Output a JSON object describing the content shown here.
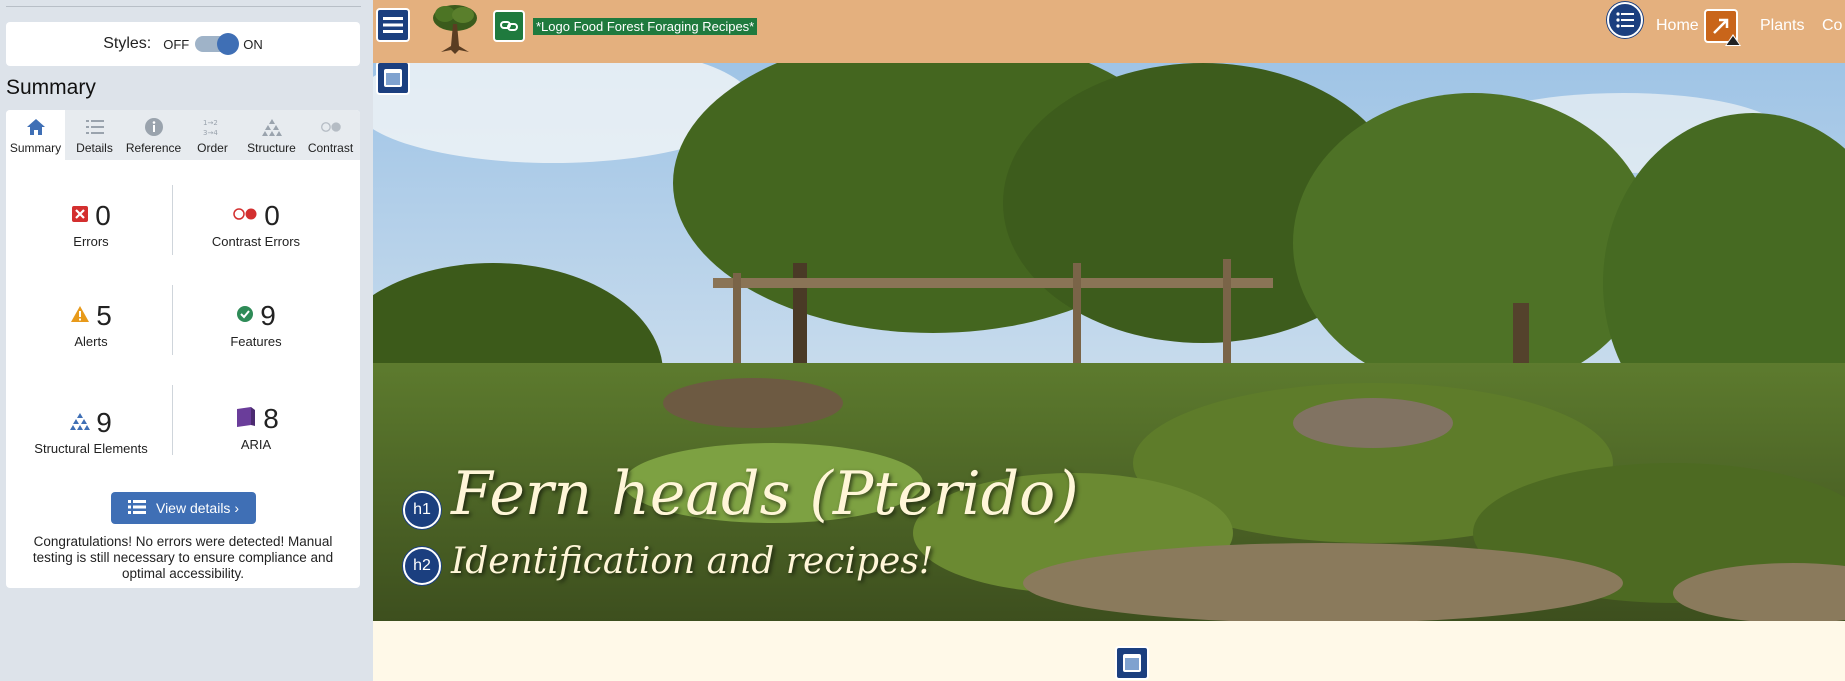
{
  "panel": {
    "styles_label": "Styles:",
    "styles_off": "OFF",
    "styles_on": "ON",
    "summary_heading": "Summary",
    "tabs": [
      {
        "label": "Summary",
        "icon": "home-icon",
        "active": true
      },
      {
        "label": "Details",
        "icon": "list-icon",
        "active": false
      },
      {
        "label": "Reference",
        "icon": "info-icon",
        "active": false
      },
      {
        "label": "Order",
        "icon": "order-icon",
        "active": false
      },
      {
        "label": "Structure",
        "icon": "structure-icon",
        "active": false
      },
      {
        "label": "Contrast",
        "icon": "contrast-icon",
        "active": false
      }
    ],
    "stats": {
      "errors": {
        "count": "0",
        "label": "Errors"
      },
      "contrast_errors": {
        "count": "0",
        "label": "Contrast Errors"
      },
      "alerts": {
        "count": "5",
        "label": "Alerts"
      },
      "features": {
        "count": "9",
        "label": "Features"
      },
      "structural": {
        "count": "9",
        "label": "Structural Elements"
      },
      "aria": {
        "count": "8",
        "label": "ARIA"
      }
    },
    "view_details": "View details ›",
    "congrats": "Congratulations! No errors were detected! Manual testing is still necessary to ensure compliance and optimal accessibility."
  },
  "site": {
    "logo_alt": "*Logo Food Forest Foraging Recipes*",
    "nav": {
      "home": "Home",
      "plants": "Plants",
      "partial": "Co"
    },
    "h1": "Fern heads (Pterido)",
    "h2": "Identification and recipes!",
    "h1_badge": "h1",
    "h2_badge": "h2"
  },
  "colors": {
    "wave_blue": "#1b3f7f",
    "button_blue": "#3f6fb5",
    "header_tan": "#e4b07e",
    "error_red": "#d32f2f",
    "alert_orange": "#e89a1a",
    "feature_green": "#2e8b57",
    "aria_purple": "#6a3d9a"
  }
}
